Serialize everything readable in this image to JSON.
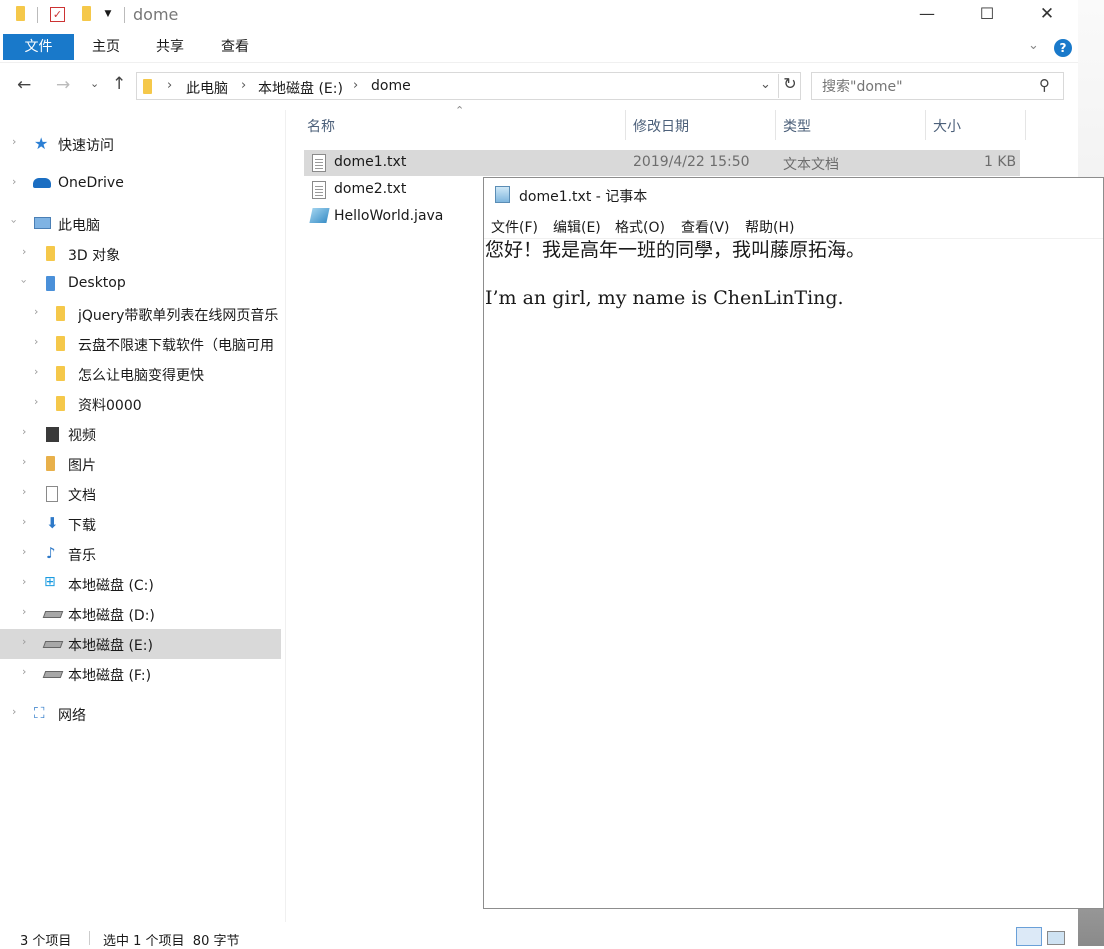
{
  "explorer": {
    "title": "dome",
    "window_buttons": {
      "minimize": "—",
      "maximize": "☐",
      "close": "✕"
    },
    "ribbon_tabs": [
      "文件",
      "主页",
      "共享",
      "查看"
    ],
    "help": "?",
    "address": {
      "crumbs": [
        "此电脑",
        "本地磁盘 (E:)",
        "dome"
      ]
    },
    "search_placeholder": "搜索\"dome\"",
    "nav_pane": [
      {
        "label": "快速访问",
        "icon": "star-icon"
      },
      {
        "label": "OneDrive",
        "icon": "cloud-icon"
      },
      {
        "label": "此电脑",
        "icon": "computer-icon"
      },
      {
        "label": "3D 对象",
        "icon": "3d-objects-icon"
      },
      {
        "label": "Desktop",
        "icon": "desktop-icon"
      },
      {
        "label": "jQuery带歌单列表在线网页音乐",
        "icon": "folder-icon"
      },
      {
        "label": "云盘不限速下载软件（电脑可用",
        "icon": "folder-icon"
      },
      {
        "label": "怎么让电脑变得更快",
        "icon": "folder-icon"
      },
      {
        "label": "资料0000",
        "icon": "folder-icon"
      },
      {
        "label": "视频",
        "icon": "videos-icon"
      },
      {
        "label": "图片",
        "icon": "pictures-icon"
      },
      {
        "label": "文档",
        "icon": "documents-icon"
      },
      {
        "label": "下载",
        "icon": "downloads-icon"
      },
      {
        "label": "音乐",
        "icon": "music-icon"
      },
      {
        "label": "本地磁盘 (C:)",
        "icon": "windows-drive-icon"
      },
      {
        "label": "本地磁盘 (D:)",
        "icon": "drive-icon"
      },
      {
        "label": "本地磁盘 (E:)",
        "icon": "drive-icon"
      },
      {
        "label": "本地磁盘 (F:)",
        "icon": "drive-icon"
      },
      {
        "label": "网络",
        "icon": "network-icon"
      }
    ],
    "columns": [
      "名称",
      "修改日期",
      "类型",
      "大小"
    ],
    "files": [
      {
        "name": "dome1.txt",
        "date": "2019/4/22 15:50",
        "type": "文本文档",
        "size": "1 KB"
      },
      {
        "name": "dome2.txt"
      },
      {
        "name": "HelloWorld.java"
      }
    ],
    "status": {
      "count": "3 个项目",
      "selected": "选中 1 个项目  80 字节"
    }
  },
  "notepad": {
    "title": "dome1.txt - 记事本",
    "menu": [
      "文件(F)",
      "编辑(E)",
      "格式(O)",
      "查看(V)",
      "帮助(H)"
    ],
    "lines": [
      "您好！我是高年一班的同學，我叫藤原拓海。",
      "",
      "I’m an girl, my name is ChenLinTing."
    ]
  }
}
